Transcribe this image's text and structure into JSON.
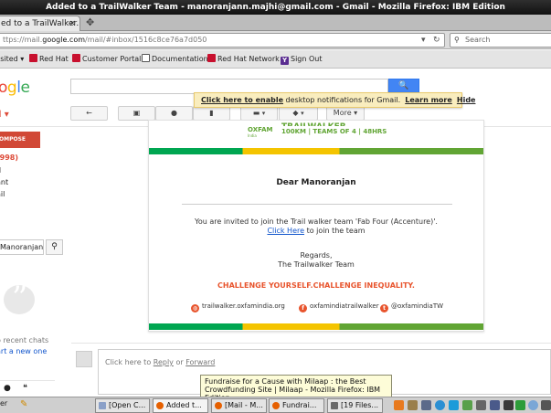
{
  "window": {
    "title": "Added to a TrailWalker Team - manoranjann.majhi@gmail.com - Gmail - Mozilla Firefox: IBM Edition"
  },
  "browser": {
    "tab_title": "ed to a TrailWalker...",
    "tab_close": "×",
    "new_tab": "✥",
    "url_prefix": "ttps://mail.",
    "url_domain": "google.com",
    "url_rest": "/mail/#inbox/1516c8ce76a7d050",
    "search_placeholder": "Search",
    "bookmarks": [
      "isited ▾",
      "Red Hat",
      "Customer Portal",
      "Documentation",
      "Red Hat Network",
      "Sign Out"
    ]
  },
  "gmail": {
    "logo": "ogle",
    "search_button": "🔍",
    "notification": {
      "link": "Click here to enable",
      "text": " desktop notifications for Gmail.",
      "learn_more": "Learn more",
      "hide": "Hide"
    },
    "label": "il ▾",
    "toolbar": {
      "more": "More ▾"
    },
    "compose": "OMPOSE",
    "nav": [
      "(998)",
      "d",
      "ant",
      "ail"
    ],
    "person_search": "Manoranjan",
    "chat": {
      "recent": "o recent chats",
      "start": "art a new one"
    }
  },
  "email": {
    "oxfam": "OXFAM",
    "oxfam_sub": "India",
    "banner": "TRAILWALKER",
    "banner_sub": "100KM | TEAMS OF 4 | 48HRS",
    "greeting": "Dear Manoranjan",
    "invite": "You are invited to join the Trail walker team 'Fab Four (Accenture)'.",
    "click_here": "Click Here",
    "click_here_suffix": " to join the team",
    "regards": "Regards,",
    "signoff": "The Trailwalker Team",
    "challenge": "CHALLENGE YOURSELF.CHALLENGE INEQUALITY.",
    "social": {
      "website": "trailwalker.oxfamindia.org",
      "facebook": "oxfamindiatrailwalker",
      "twitter": "@oxfamindiaTW"
    }
  },
  "reply": {
    "prefix": "Click here to ",
    "reply": "Reply",
    "or": " or ",
    "forward": "Forward"
  },
  "tooltip": {
    "line1": "Fundraise for a Cause with Milaap : the Best",
    "line2": "Crowdfunding Site | Milaap - Mozilla Firefox: IBM Edition"
  },
  "taskbar": {
    "start": "er",
    "items": [
      "[Open C...",
      "Added t...",
      "[Mail - M...",
      "Fundrai...",
      "[19 Files..."
    ]
  },
  "colors": {
    "gmail_red": "#dd4b39",
    "google_blue": "#4285f4",
    "oxfam_green": "#61a534",
    "challenge_orange": "#e8542d"
  }
}
